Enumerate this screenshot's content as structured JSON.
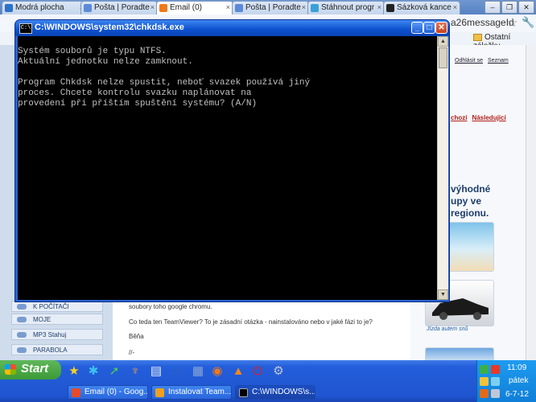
{
  "browser": {
    "tabs": [
      {
        "label": "Modrá plocha",
        "close": "×",
        "color": "#2b72c8"
      },
      {
        "label": "Pošta | Poradte",
        "close": "×",
        "color": "#5b8ad8"
      },
      {
        "label": "Email (0)",
        "close": "×",
        "color": "#f07a1a"
      },
      {
        "label": "Pošta | Poradte",
        "close": "×",
        "color": "#5b8ad8"
      },
      {
        "label": "Stáhnout progr",
        "close": "×",
        "color": "#3aa0d8"
      },
      {
        "label": "Sázková kance",
        "close": "×",
        "color": "#222222"
      }
    ],
    "window_buttons": {
      "minimize": "–",
      "restore": "❐",
      "close": "✕"
    },
    "address_fragment": "a26messageId",
    "bookmark_folder": "Ostatní záložky"
  },
  "page": {
    "header_links": [
      "Odhlásit se",
      "Seznam"
    ],
    "nav_links": [
      "chozí",
      "Následující"
    ],
    "promo_lines": [
      "výhodné",
      "upy ve",
      "regionu."
    ],
    "ad_caption": "Jízda autem snů",
    "nav_items": [
      "K POČÍTAČI",
      "MOJE",
      "MP3 Stahuj",
      "PARABOLA"
    ],
    "body_lines": [
      "soubory toho google chromu.",
      "Co teda ten TeamViewer? To je zásadní otázka - nainstalováno nebo v jaké fázi to je?",
      "Běňa",
      "//-"
    ]
  },
  "console": {
    "title": "C:\\WINDOWS\\system32\\chkdsk.exe",
    "icon_text": "C:\\",
    "lines": [
      "Systém souborů je typu NTFS.",
      "Aktuální jednotku nelze zamknout.",
      "",
      "Program Chkdsk nelze spustit, neboť svazek používá jiný",
      "proces. Chcete kontrolu svazku naplánovat na",
      "provedení při příštím spuštění systému? (A/N)"
    ],
    "buttons": {
      "minimize": "_",
      "maximize": "□",
      "close": "✕"
    },
    "scroll_up": "▲",
    "scroll_down": "▼"
  },
  "taskbar": {
    "start_label": "Start",
    "quick_launch": [
      {
        "icon": "star-icon",
        "glyph": "★",
        "color": "#ffd21a"
      },
      {
        "icon": "pinwheel-icon",
        "glyph": "✱",
        "color": "#3ec2f0"
      },
      {
        "icon": "green-arrow-icon",
        "glyph": "➚",
        "color": "#4cd04c"
      },
      {
        "icon": "winamp-icon",
        "glyph": "♆",
        "color": "#f2a23a"
      },
      {
        "icon": "notepad-icon",
        "glyph": "▤",
        "color": "#e8eef8"
      },
      {
        "icon": "word-icon",
        "glyph": "W",
        "color": "#2b5fc8"
      },
      {
        "icon": "gallery-icon",
        "glyph": "▦",
        "color": "#8aa8d8"
      },
      {
        "icon": "firefox-icon",
        "glyph": "◉",
        "color": "#f07a1a"
      },
      {
        "icon": "vlc-icon",
        "glyph": "▲",
        "color": "#f08a1a"
      },
      {
        "icon": "power-icon",
        "glyph": "⏻",
        "color": "#d82020"
      },
      {
        "icon": "network-icon",
        "glyph": "⚙",
        "color": "#c0c8d8"
      }
    ],
    "windows": [
      {
        "label": "Email (0) - Goog...",
        "color": "#e84a2a"
      },
      {
        "label": "Instalovat Team...",
        "color": "#f0a020"
      },
      {
        "label": "C:\\WINDOWS\\s...",
        "color": "#000000"
      }
    ],
    "clock": "11:09",
    "day": "pátek",
    "date": "6-7-12"
  }
}
